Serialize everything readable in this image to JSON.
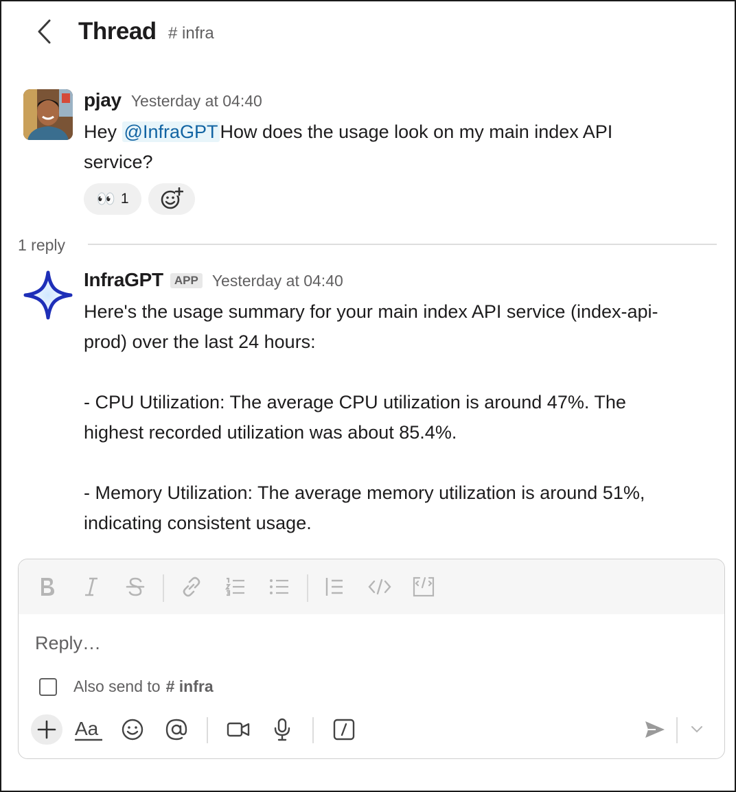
{
  "header": {
    "title": "Thread",
    "channel": "# infra"
  },
  "parent_message": {
    "author": "pjay",
    "timestamp": "Yesterday at 04:40",
    "text_before": "Hey ",
    "mention": "@InfraGPT",
    "text_line1_after": "How does the usage look on my main index API",
    "text_line2": "service?",
    "reactions": [
      {
        "emoji": "👀",
        "count": "1"
      }
    ]
  },
  "replies_divider": "1 reply",
  "reply_message": {
    "author": "InfraGPT",
    "badge": "APP",
    "timestamp": "Yesterday at 04:40",
    "lines": [
      "Here's the usage summary for your main index API service (index-api-",
      "prod) over the last 24 hours:",
      "",
      "- CPU Utilization: The average CPU utilization is around 47%. The",
      "highest recorded utilization was about 85.4%.",
      "",
      "- Memory Utilization: The average memory utilization is around 51%,",
      "indicating consistent usage."
    ]
  },
  "composer": {
    "placeholder": "Reply…",
    "also_send_label": "Also send to",
    "also_send_channel": "# infra",
    "formatting": [
      "bold-icon",
      "italic-icon",
      "strikethrough-icon",
      "link-icon",
      "ordered-list-icon",
      "bullet-list-icon",
      "blockquote-icon",
      "code-icon",
      "code-block-icon"
    ],
    "toolbar": [
      "plus-icon",
      "text-format-icon",
      "emoji-icon",
      "mention-icon",
      "video-icon",
      "microphone-icon",
      "slash-command-icon",
      "send-icon",
      "chevron-down-icon"
    ]
  },
  "colors": {
    "mention_text": "#1264a3",
    "mention_bg": "#e8f5fa",
    "bot_icon": "#1e2fb8",
    "muted_text": "#616061"
  }
}
